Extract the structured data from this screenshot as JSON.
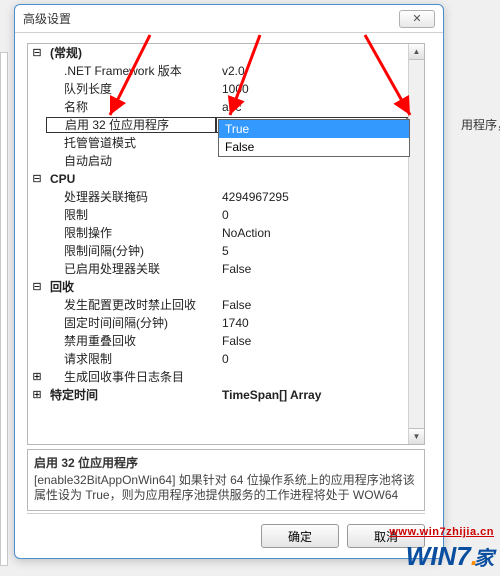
{
  "window": {
    "title": "高级设置",
    "close_glyph": "✕"
  },
  "background_hint": "用程序，并提供",
  "categories": {
    "general": "(常规)",
    "cpu": "CPU",
    "recycle": "回收",
    "schedule": "特定时间"
  },
  "rows": {
    "net_fw": {
      "label": ".NET Framework 版本",
      "value": "v2.0"
    },
    "queue_len": {
      "label": "队列长度",
      "value": "1000"
    },
    "name": {
      "label": "名称",
      "value": "abc"
    },
    "enable32": {
      "label": "启用 32 位应用程序",
      "value": "True"
    },
    "pipeline": {
      "label": "托管管道模式",
      "value": ""
    },
    "autostart": {
      "label": "自动启动",
      "value": ""
    },
    "cpu_mask": {
      "label": "处理器关联掩码",
      "value": "4294967295"
    },
    "cpu_limit": {
      "label": "限制",
      "value": "0"
    },
    "cpu_action": {
      "label": "限制操作",
      "value": "NoAction"
    },
    "cpu_interval": {
      "label": "限制间隔(分钟)",
      "value": "5"
    },
    "cpu_affin": {
      "label": "已启用处理器关联",
      "value": "False"
    },
    "rc_config": {
      "label": "发生配置更改时禁止回收",
      "value": "False"
    },
    "rc_interval": {
      "label": "固定时间间隔(分钟)",
      "value": "1740"
    },
    "rc_overlap": {
      "label": "禁用重叠回收",
      "value": "False"
    },
    "rc_reqlimit": {
      "label": "请求限制",
      "value": "0"
    },
    "rc_eventlog": {
      "label": "生成回收事件日志条目",
      "value": ""
    },
    "schedule_val": {
      "label": "特定时间",
      "value": "TimeSpan[] Array"
    }
  },
  "dropdown": {
    "opt_true": "True",
    "opt_false": "False"
  },
  "description": {
    "title": "启用 32 位应用程序",
    "body": "[enable32BitAppOnWin64] 如果针对 64 位操作系统上的应用程序池将该属性设为 True，则为应用程序池提供服务的工作进程将处于 WOW64"
  },
  "buttons": {
    "ok": "确定",
    "cancel": "取消"
  },
  "glyphs": {
    "plus": "⊞",
    "minus": "⊟",
    "down": "▼",
    "up": "▲"
  },
  "watermark": "www.win7zhijia.cn",
  "logo": {
    "main": "WIN",
    "seven": "7",
    "suffix": "家"
  }
}
